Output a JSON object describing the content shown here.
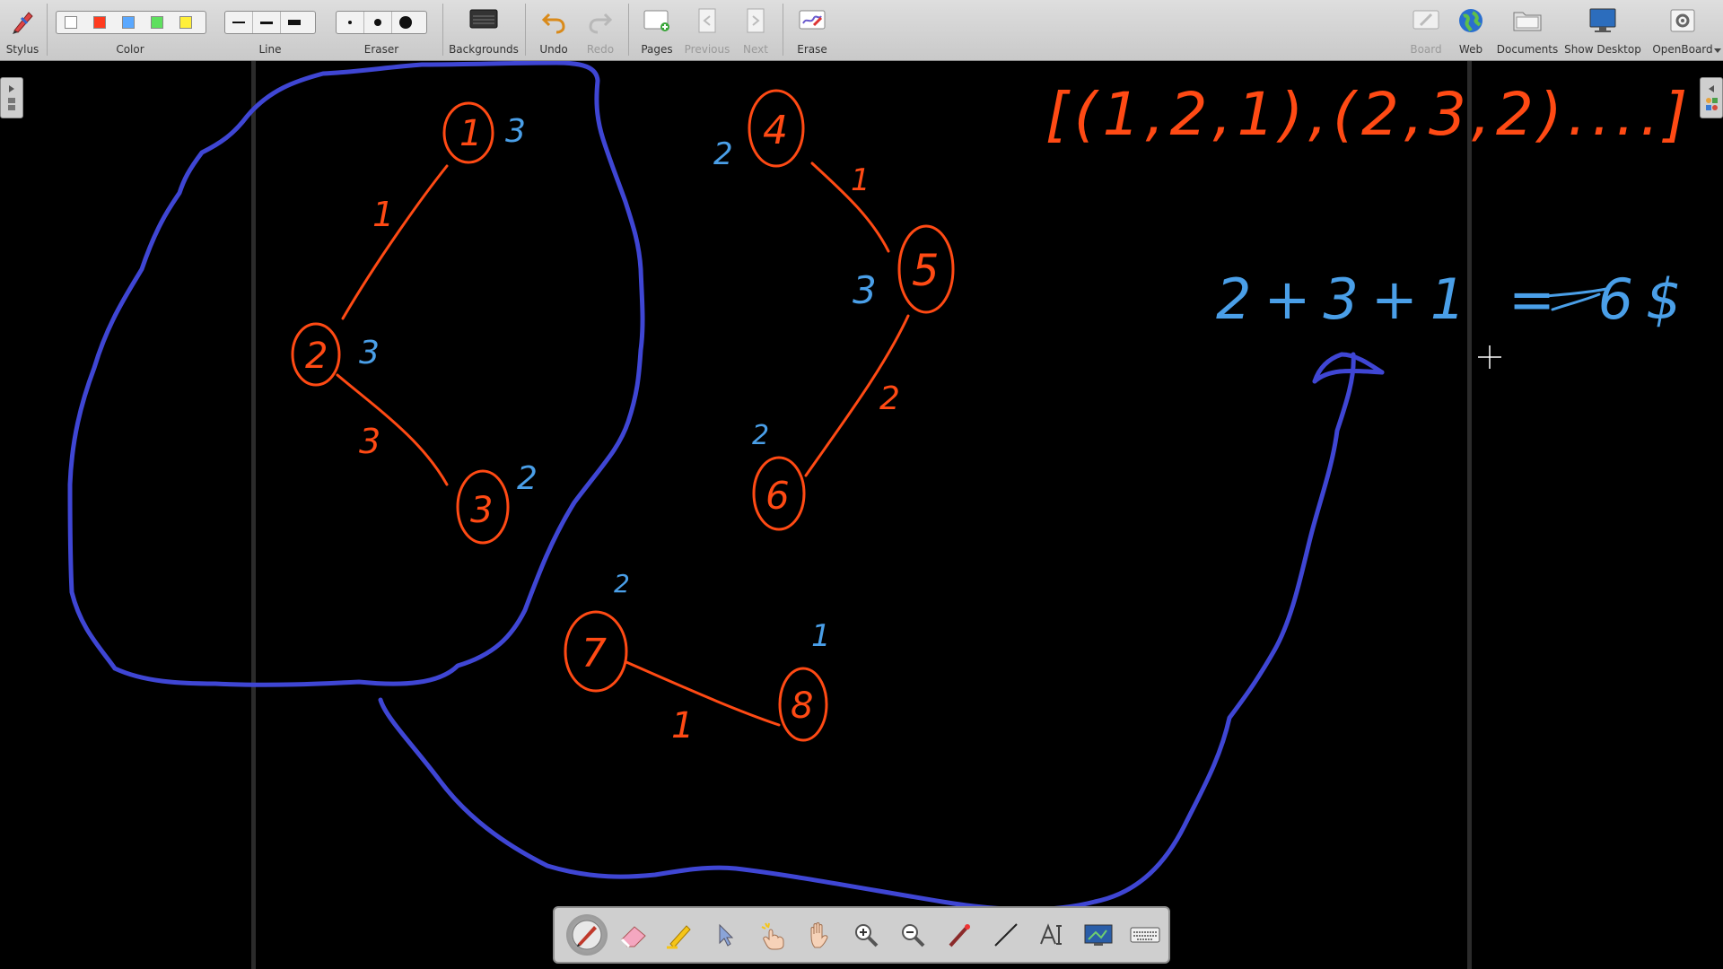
{
  "toolbar": {
    "stylus": "Stylus",
    "color": "Color",
    "line": "Line",
    "eraser": "Eraser",
    "backgrounds": "Backgrounds",
    "undo": "Undo",
    "redo": "Redo",
    "pages": "Pages",
    "previous": "Previous",
    "next": "Next",
    "erase": "Erase",
    "board": "Board",
    "web": "Web",
    "documents": "Documents",
    "show_desktop": "Show Desktop",
    "openboard": "OpenBoard"
  },
  "palette_colors": [
    "#ffffff",
    "#ff3b1f",
    "#5aa8ff",
    "#5fe05f",
    "#ffef3a"
  ],
  "ink_colors": {
    "red": "#ff4a14",
    "blue": "#4a9fe8",
    "outline": "#3f46d4"
  },
  "graph": {
    "nodes": [
      "1",
      "2",
      "3",
      "4",
      "5",
      "6",
      "7",
      "8"
    ],
    "node_weights": [
      "3",
      "3",
      "2",
      "2",
      "3",
      "2",
      "2",
      "1"
    ],
    "edge_weights": [
      "1",
      "3",
      "1",
      "2",
      "1"
    ]
  },
  "notes": {
    "list": "[(1,2,1),(2,3,2)....]",
    "sum": "2+3+1 = 6$"
  },
  "dock_tools": [
    "pen-icon",
    "eraser-icon",
    "marker-icon",
    "selector-icon",
    "laser-pointer-icon",
    "hand-icon",
    "zoom-in-icon",
    "zoom-out-icon",
    "pointer-icon",
    "line-icon",
    "text-icon",
    "capture-icon",
    "keyboard-icon"
  ]
}
